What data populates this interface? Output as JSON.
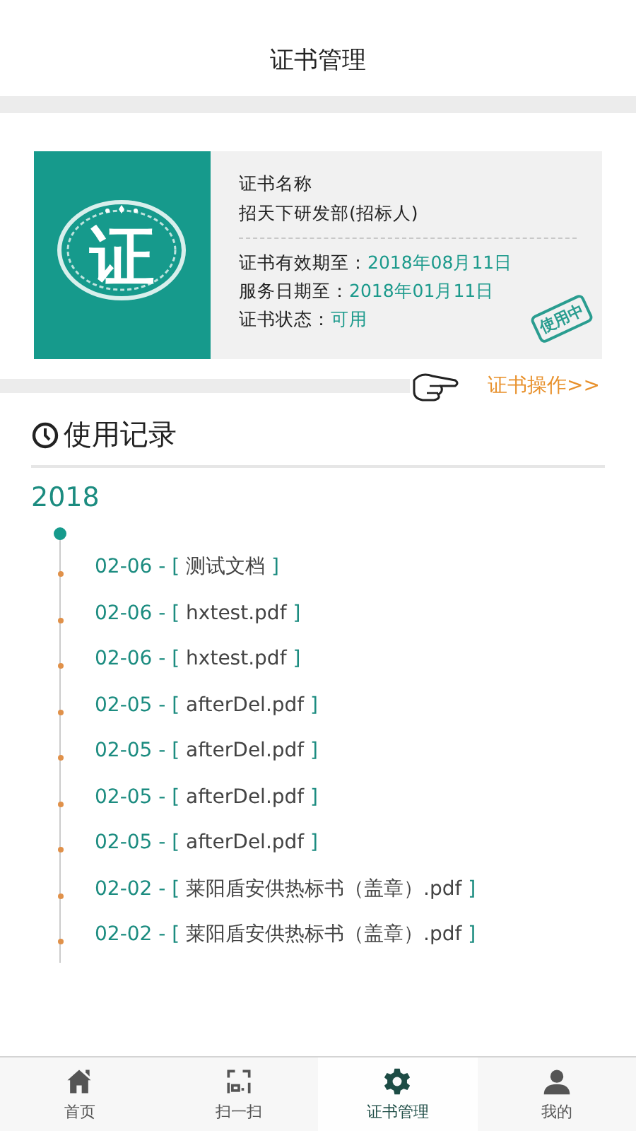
{
  "header": {
    "title": "证书管理"
  },
  "certificate": {
    "seal_text": "证",
    "name_label": "证书名称",
    "name": "招天下研发部(招标人)",
    "fields": [
      {
        "label": "证书有效期至：",
        "value": "2018年08月11日"
      },
      {
        "label": "服务日期至：",
        "value": "2018年01月11日"
      },
      {
        "label": "证书状态：",
        "value": "可用"
      }
    ],
    "stamp": "使用中",
    "action": "证书操作>>"
  },
  "records": {
    "title": "使用记录",
    "year": "2018",
    "items": [
      {
        "date": "02-06 - [",
        "file": "测试文档",
        "end": "]"
      },
      {
        "date": "02-06 - [",
        "file": "hxtest.pdf",
        "end": "]"
      },
      {
        "date": "02-06 - [",
        "file": "hxtest.pdf",
        "end": "]"
      },
      {
        "date": "02-05 - [",
        "file": "afterDel.pdf",
        "end": "]"
      },
      {
        "date": "02-05 - [",
        "file": "afterDel.pdf",
        "end": "]"
      },
      {
        "date": "02-05 - [",
        "file": "afterDel.pdf",
        "end": "]"
      },
      {
        "date": "02-05 - [",
        "file": "afterDel.pdf",
        "end": "]"
      },
      {
        "date": "02-02 - [",
        "file": "莱阳盾安供热标书（盖章）.pdf",
        "end": "]"
      },
      {
        "date": "02-02 - [",
        "file": "莱阳盾安供热标书（盖章）.pdf",
        "end": "]"
      }
    ]
  },
  "tabs": [
    {
      "label": "首页",
      "kind": "home",
      "selected": false
    },
    {
      "label": "扫一扫",
      "kind": "scan",
      "selected": false
    },
    {
      "label": "证书管理",
      "kind": "gear",
      "selected": true
    },
    {
      "label": "我的",
      "kind": "user",
      "selected": false
    }
  ]
}
